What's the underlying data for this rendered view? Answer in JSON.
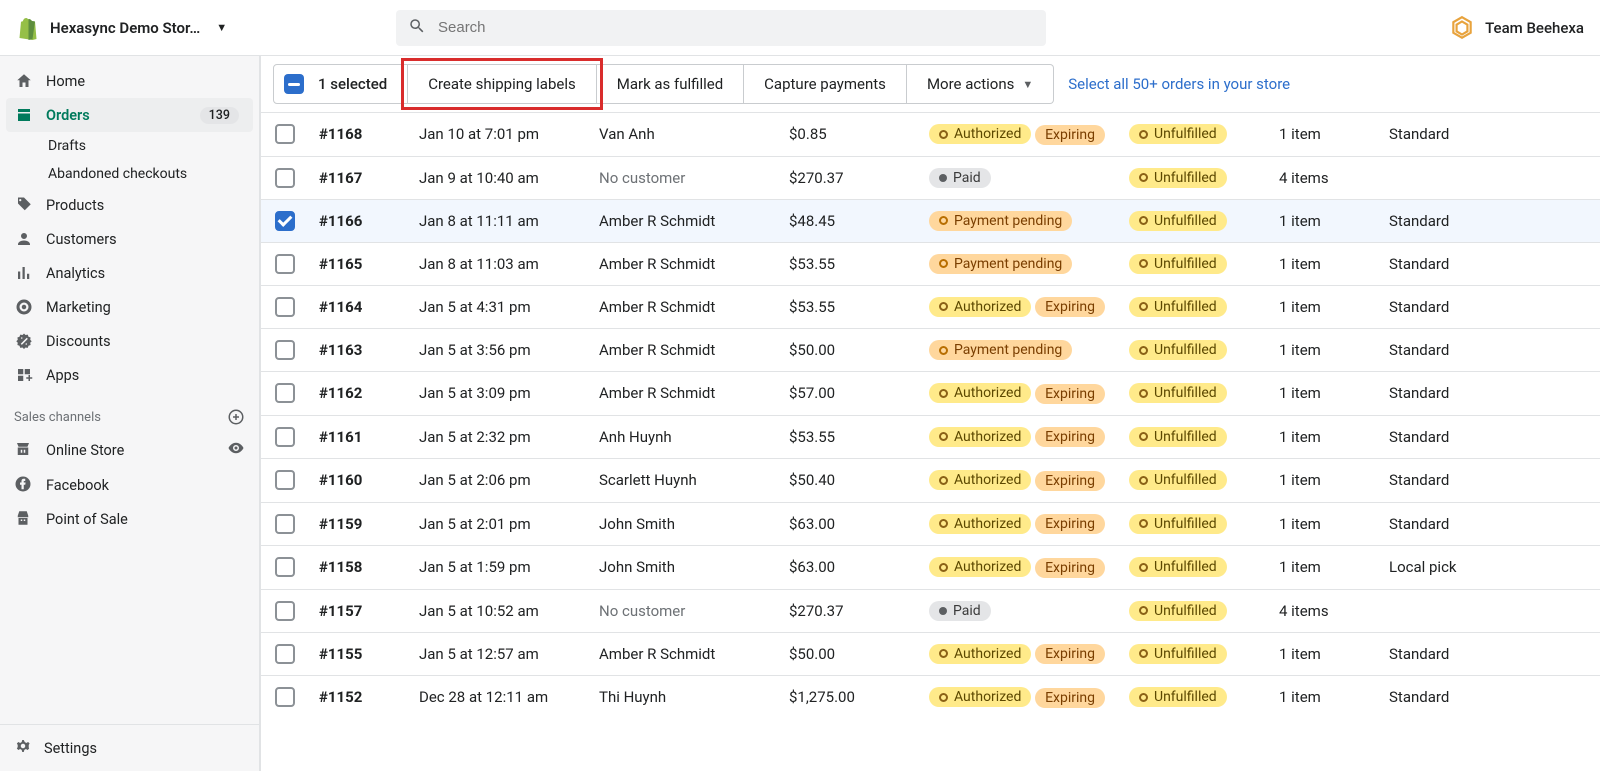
{
  "topbar": {
    "store_name": "Hexasync Demo Stor…",
    "search_placeholder": "Search",
    "user_name": "Team Beehexa"
  },
  "sidebar": {
    "items": [
      {
        "label": "Home"
      },
      {
        "label": "Orders",
        "badge": "139"
      },
      {
        "label": "Drafts"
      },
      {
        "label": "Abandoned checkouts"
      },
      {
        "label": "Products"
      },
      {
        "label": "Customers"
      },
      {
        "label": "Analytics"
      },
      {
        "label": "Marketing"
      },
      {
        "label": "Discounts"
      },
      {
        "label": "Apps"
      }
    ],
    "channels_title": "Sales channels",
    "channels": [
      {
        "label": "Online Store"
      },
      {
        "label": "Facebook"
      },
      {
        "label": "Point of Sale"
      }
    ],
    "settings": "Settings"
  },
  "bulk": {
    "count_text": "1 selected",
    "create_labels": "Create shipping labels",
    "mark_fulfilled": "Mark as fulfilled",
    "capture_payments": "Capture payments",
    "more_actions": "More actions",
    "select_all": "Select all 50+ orders in your store"
  },
  "badges": {
    "authorized": "Authorized",
    "payment_pending": "Payment pending",
    "paid": "Paid",
    "expiring": "Expiring",
    "unfulfilled": "Unfulfilled"
  },
  "orders": [
    {
      "id": "#1168",
      "date": "Jan 10 at 7:01 pm",
      "customer": "Van Anh",
      "total": "$0.85",
      "payment": "authorized",
      "expiring": true,
      "fulfill": "unfulfilled",
      "items": "1 item",
      "delivery": "Standard",
      "selected": false
    },
    {
      "id": "#1167",
      "date": "Jan 9 at 10:40 am",
      "customer": "No customer",
      "no_customer": true,
      "total": "$270.37",
      "payment": "paid",
      "expiring": false,
      "fulfill": "unfulfilled",
      "items": "4 items",
      "delivery": "",
      "selected": false
    },
    {
      "id": "#1166",
      "date": "Jan 8 at 11:11 am",
      "customer": "Amber R Schmidt",
      "total": "$48.45",
      "payment": "pending",
      "expiring": false,
      "fulfill": "unfulfilled",
      "items": "1 item",
      "delivery": "Standard",
      "selected": true
    },
    {
      "id": "#1165",
      "date": "Jan 8 at 11:03 am",
      "customer": "Amber R Schmidt",
      "total": "$53.55",
      "payment": "pending",
      "expiring": false,
      "fulfill": "unfulfilled",
      "items": "1 item",
      "delivery": "Standard",
      "selected": false
    },
    {
      "id": "#1164",
      "date": "Jan 5 at 4:31 pm",
      "customer": "Amber R Schmidt",
      "total": "$53.55",
      "payment": "authorized",
      "expiring": true,
      "fulfill": "unfulfilled",
      "items": "1 item",
      "delivery": "Standard",
      "selected": false
    },
    {
      "id": "#1163",
      "date": "Jan 5 at 3:56 pm",
      "customer": "Amber R Schmidt",
      "total": "$50.00",
      "payment": "pending",
      "expiring": false,
      "fulfill": "unfulfilled",
      "items": "1 item",
      "delivery": "Standard",
      "selected": false
    },
    {
      "id": "#1162",
      "date": "Jan 5 at 3:09 pm",
      "customer": "Amber R Schmidt",
      "total": "$57.00",
      "payment": "authorized",
      "expiring": true,
      "fulfill": "unfulfilled",
      "items": "1 item",
      "delivery": "Standard",
      "selected": false
    },
    {
      "id": "#1161",
      "date": "Jan 5 at 2:32 pm",
      "customer": "Anh Huynh",
      "total": "$53.55",
      "payment": "authorized",
      "expiring": true,
      "fulfill": "unfulfilled",
      "items": "1 item",
      "delivery": "Standard",
      "selected": false
    },
    {
      "id": "#1160",
      "date": "Jan 5 at 2:06 pm",
      "customer": "Scarlett Huynh",
      "total": "$50.40",
      "payment": "authorized",
      "expiring": true,
      "fulfill": "unfulfilled",
      "items": "1 item",
      "delivery": "Standard",
      "selected": false
    },
    {
      "id": "#1159",
      "date": "Jan 5 at 2:01 pm",
      "customer": "John Smith",
      "total": "$63.00",
      "payment": "authorized",
      "expiring": true,
      "fulfill": "unfulfilled",
      "items": "1 item",
      "delivery": "Standard",
      "selected": false
    },
    {
      "id": "#1158",
      "date": "Jan 5 at 1:59 pm",
      "customer": "John Smith",
      "total": "$63.00",
      "payment": "authorized",
      "expiring": true,
      "fulfill": "unfulfilled",
      "items": "1 item",
      "delivery": "Local pick",
      "selected": false
    },
    {
      "id": "#1157",
      "date": "Jan 5 at 10:52 am",
      "customer": "No customer",
      "no_customer": true,
      "total": "$270.37",
      "payment": "paid",
      "expiring": false,
      "fulfill": "unfulfilled",
      "items": "4 items",
      "delivery": "",
      "selected": false
    },
    {
      "id": "#1155",
      "date": "Jan 5 at 12:57 am",
      "customer": "Amber R Schmidt",
      "total": "$50.00",
      "payment": "authorized",
      "expiring": true,
      "fulfill": "unfulfilled",
      "items": "1 item",
      "delivery": "Standard",
      "selected": false
    },
    {
      "id": "#1152",
      "date": "Dec 28 at 12:11 am",
      "customer": "Thi Huynh",
      "total": "$1,275.00",
      "payment": "authorized",
      "expiring": true,
      "fulfill": "unfulfilled",
      "items": "1 item",
      "delivery": "Standard",
      "selected": false
    }
  ]
}
